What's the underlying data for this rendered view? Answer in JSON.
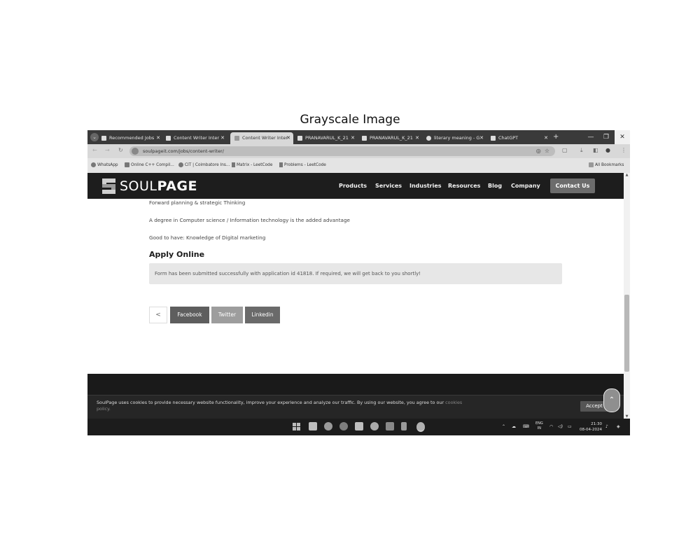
{
  "figure_title": "Grayscale Image",
  "tabs": [
    {
      "label": "Recommended Jobs",
      "active": false
    },
    {
      "label": "Content Writer Inter",
      "active": false
    },
    {
      "label": "Content Writer Inter",
      "active": true
    },
    {
      "label": "PRANAVARUL_K_21",
      "active": false
    },
    {
      "label": "PRANAVARUL_K_21",
      "active": false
    },
    {
      "label": "literary meaning - G",
      "active": false
    },
    {
      "label": "ChatGPT",
      "active": false
    }
  ],
  "address_bar": {
    "url": "soulpageit.com/jobs/content-writer/"
  },
  "bookmarks": [
    "WhatsApp",
    "Online C++ Compil...",
    "CIT | Coimbatore Ins...",
    "Matrix - LeetCode",
    "Problems - LeetCode"
  ],
  "all_bookmarks": "All Bookmarks",
  "site_header": {
    "logo_light": "SOUL",
    "logo_bold": "PAGE",
    "nav": [
      "Products",
      "Services",
      "Industries",
      "Resources",
      "Blog",
      "Company"
    ],
    "contact_button": "Contact Us"
  },
  "content": {
    "line1": "Forward planning & strategic Thinking",
    "line2": "A degree in Computer science / Information technology is the added advantage",
    "line3": "Good to have: Knowledge of Digital marketing",
    "apply_heading": "Apply Online",
    "success_message": "Form has been submitted successfully with application id 41818. If required, we will get back to you shortly!",
    "share_buttons": [
      "Facebook",
      "Twitter",
      "Linkedin"
    ]
  },
  "cookie_bar": {
    "text": "SoulPage uses cookies to provide necessary website functionality, improve your experience and analyze our traffic. By using our website, you agree to our",
    "link": "cookies policy.",
    "accept": "Accept"
  },
  "taskbar": {
    "lang_line1": "ENG",
    "lang_line2": "IN",
    "time": "21:30",
    "date": "08-04-2024"
  }
}
